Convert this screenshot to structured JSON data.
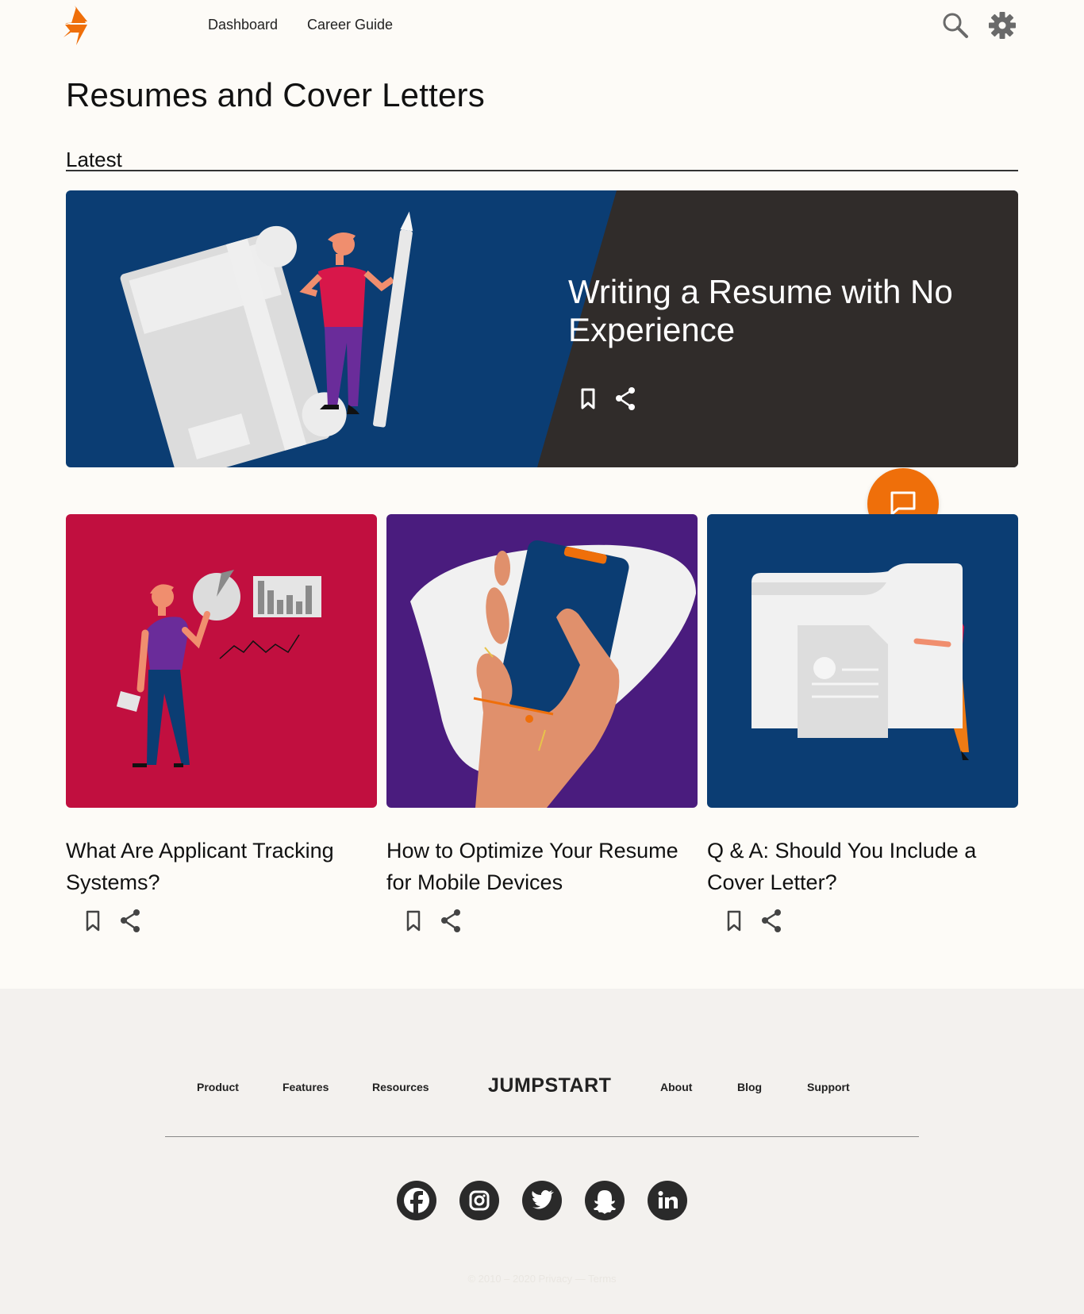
{
  "header": {
    "nav": [
      "Dashboard",
      "Career Guide"
    ]
  },
  "page": {
    "title": "Resumes and Cover Letters",
    "section_label": "Latest"
  },
  "hero": {
    "title": "Writing a Resume with No Experience"
  },
  "cards": [
    {
      "title": "What Are Applicant Tracking Systems?"
    },
    {
      "title": "How to Optimize Your Resume for Mobile  Devices"
    },
    {
      "title": "Q & A: Should You Include a Cover Letter?"
    }
  ],
  "footer": {
    "links_left": [
      "Product",
      "Features",
      "Resources"
    ],
    "brand": "JUMPSTART",
    "links_right": [
      "About",
      "Blog",
      "Support"
    ],
    "copyright": "© 2010 – 2020  Privacy — Terms"
  },
  "colors": {
    "accent": "#ef6f0a",
    "navy": "#0b3d73",
    "hero_dark": "#302c2a",
    "crimson": "#c10f3f",
    "purple": "#4a1c7e"
  },
  "icons": [
    "lightning-logo",
    "search-icon",
    "gear-icon",
    "bookmark-icon",
    "share-icon",
    "chat-icon",
    "facebook-icon",
    "instagram-icon",
    "twitter-icon",
    "snapchat-icon",
    "linkedin-icon"
  ]
}
